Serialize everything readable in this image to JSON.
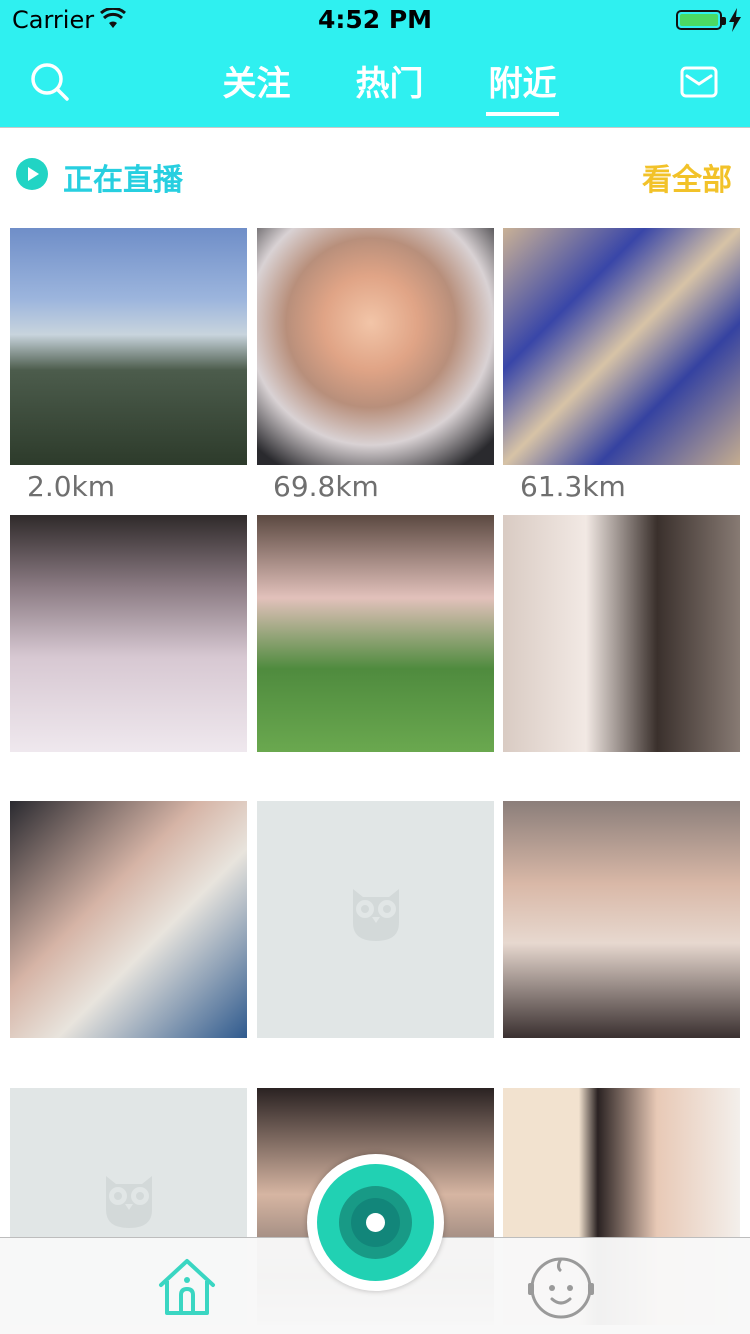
{
  "status_bar": {
    "carrier": "Carrier",
    "time": "4:52 PM"
  },
  "nav": {
    "tabs": [
      {
        "label": "关注",
        "active": false
      },
      {
        "label": "热门",
        "active": false
      },
      {
        "label": "附近",
        "active": true
      }
    ]
  },
  "live_section": {
    "title": "正在直播",
    "see_all": "看全部"
  },
  "grid": {
    "cells": [
      {
        "kind": "photo",
        "distance": "2.0km"
      },
      {
        "kind": "photo",
        "distance": "69.8km"
      },
      {
        "kind": "photo",
        "distance": "61.3km"
      },
      {
        "kind": "photo"
      },
      {
        "kind": "photo"
      },
      {
        "kind": "photo"
      },
      {
        "kind": "photo"
      },
      {
        "kind": "placeholder",
        "icon": "owl-icon"
      },
      {
        "kind": "photo"
      },
      {
        "kind": "placeholder",
        "icon": "owl-icon"
      },
      {
        "kind": "photo"
      },
      {
        "kind": "photo"
      }
    ]
  },
  "colors": {
    "nav_background": "#2ff0f0",
    "live_title": "#27cfe0",
    "see_all": "#f2c229",
    "record_button": "#21d1b3",
    "tab_icon": "#3ad6c2"
  },
  "tab_bar": {
    "items": [
      {
        "icon": "home-icon"
      },
      {
        "icon": "record-icon"
      },
      {
        "icon": "profile-icon"
      }
    ]
  }
}
